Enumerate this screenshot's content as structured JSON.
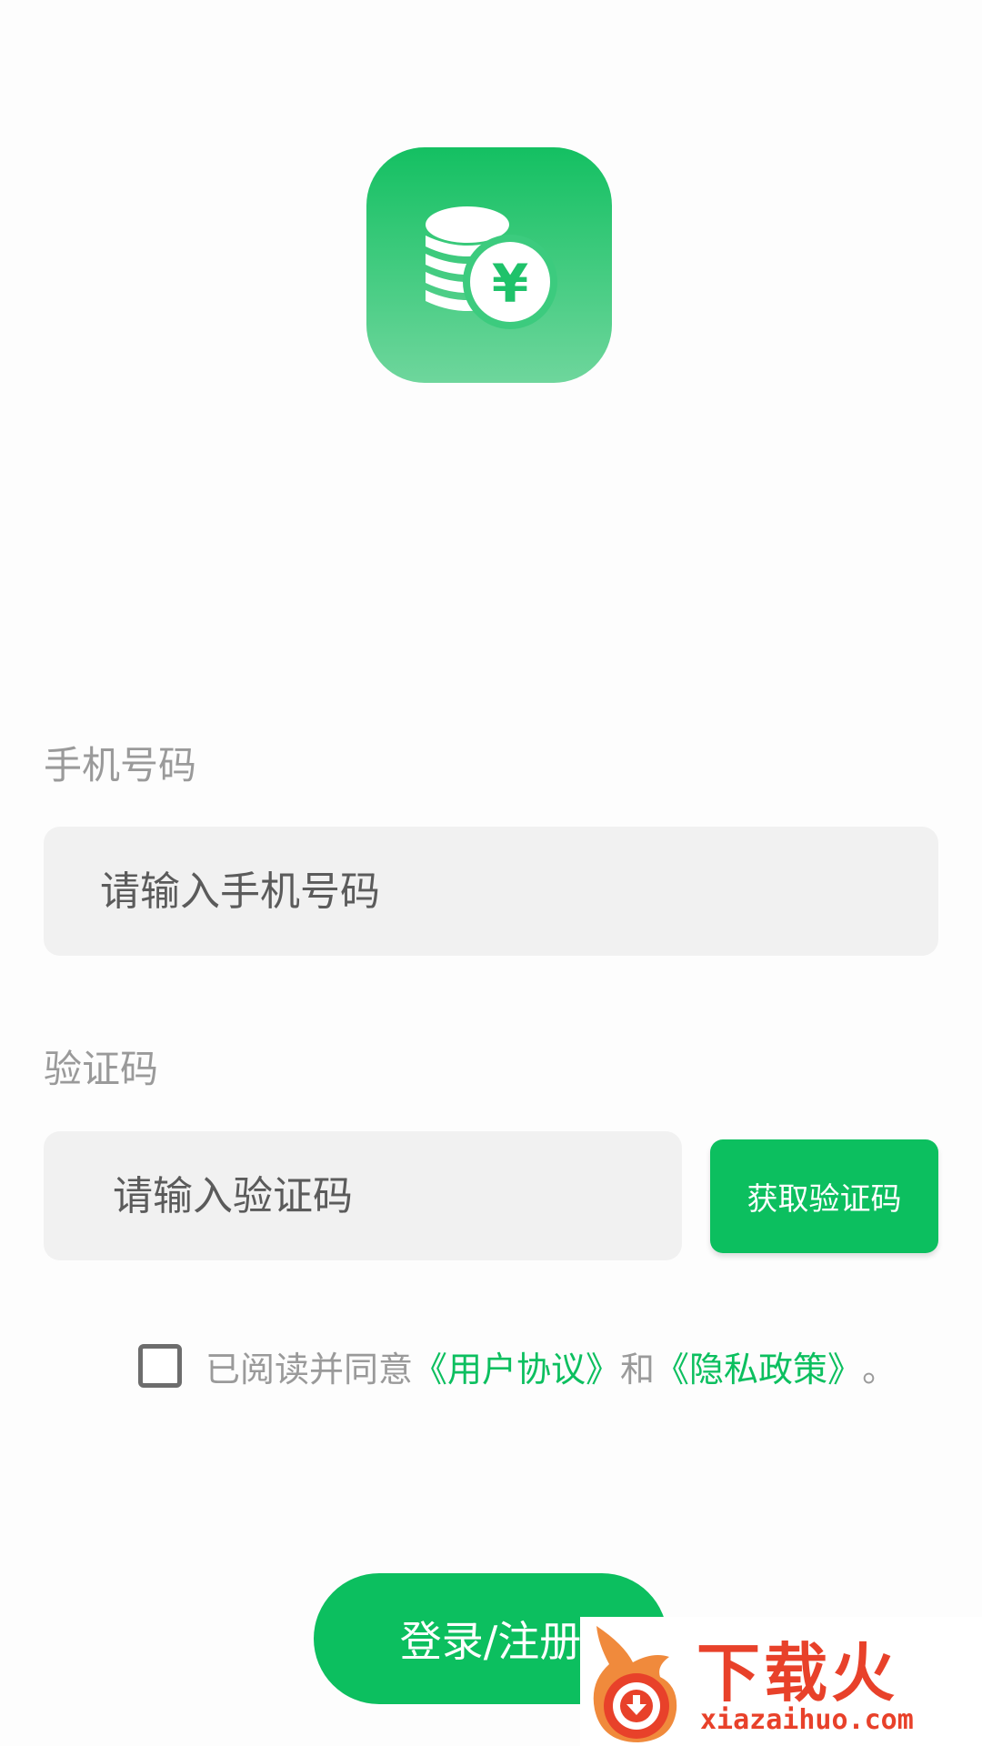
{
  "logo": {
    "icon": "coins-yuan-icon",
    "symbol": "¥",
    "colors": {
      "top": "#14c062",
      "bottom": "#6ed69c"
    }
  },
  "phone": {
    "label": "手机号码",
    "placeholder": "请输入手机号码",
    "value": ""
  },
  "code": {
    "label": "验证码",
    "placeholder": "请输入验证码",
    "value": "",
    "get_code_label": "获取验证码"
  },
  "agreement": {
    "checked": false,
    "prefix": "已阅读并同意",
    "user_agreement": "《用户协议》",
    "conjunction": "和",
    "privacy_policy": "《隐私政策》",
    "suffix": "。"
  },
  "login": {
    "label": "登录/注册"
  },
  "watermark": {
    "title": "下载火",
    "url": "xiazaihuo.com"
  },
  "colors": {
    "accent": "#0cbf5f",
    "label_gray": "#9a9a9a",
    "input_bg": "#f1f1f1",
    "watermark_red": "#e8412a"
  }
}
